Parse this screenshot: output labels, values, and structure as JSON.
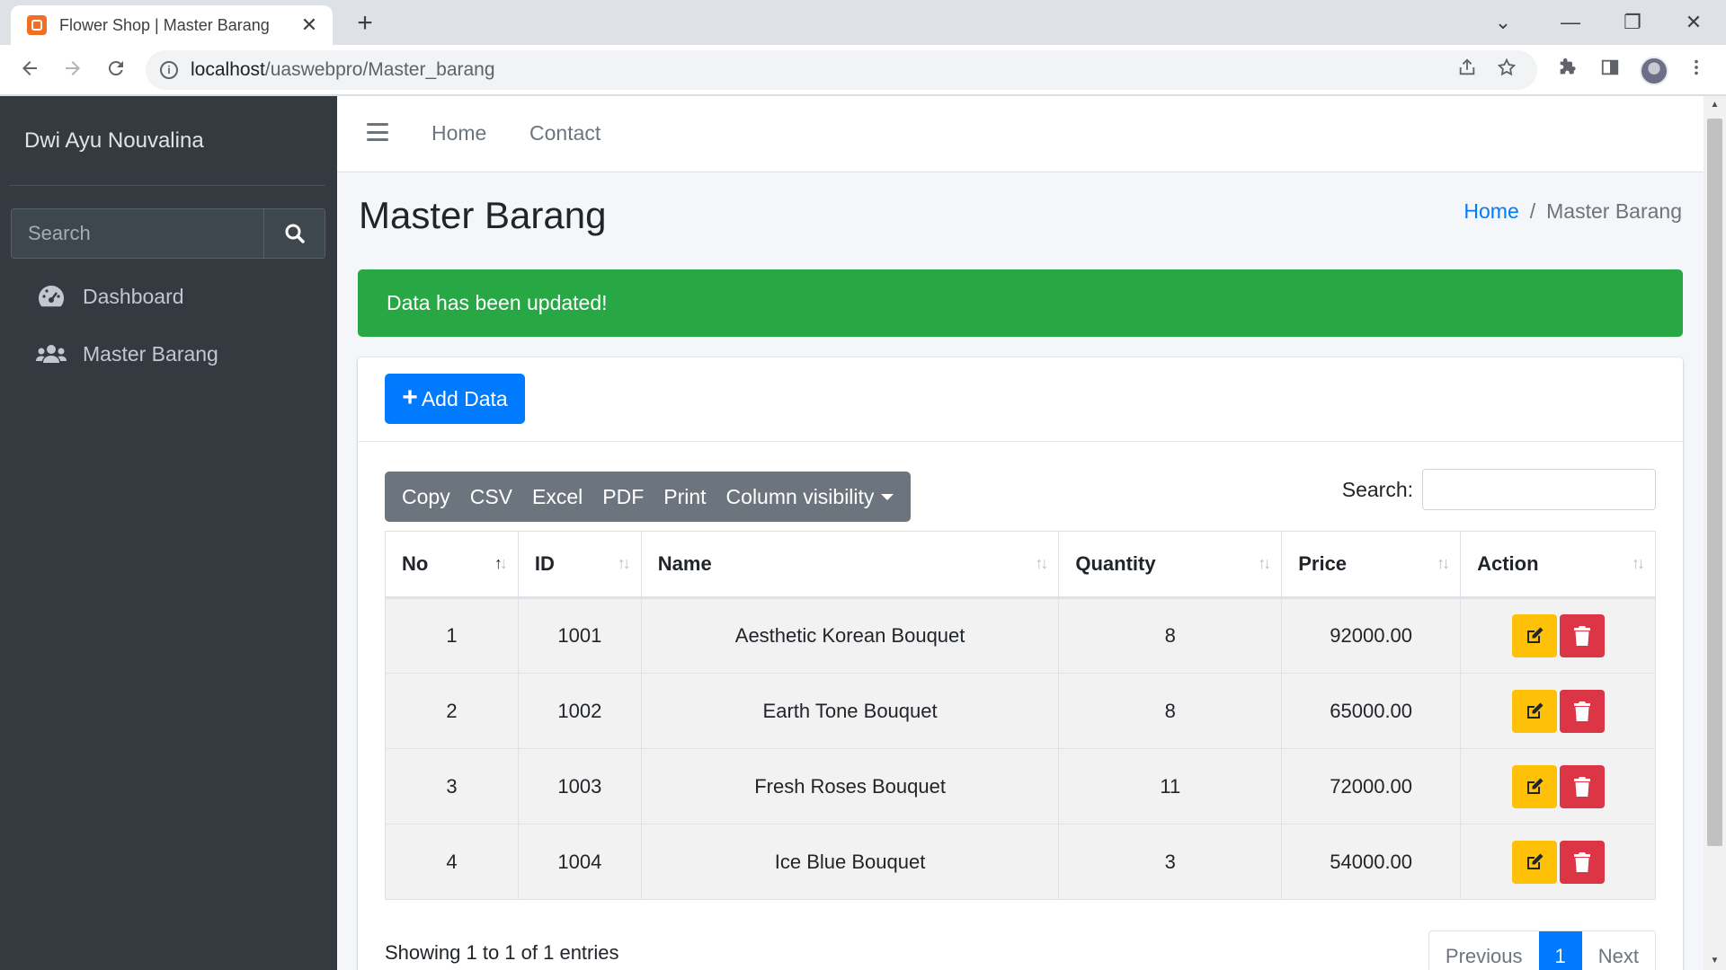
{
  "browser": {
    "tab_title": "Flower Shop | Master Barang",
    "tab_close": "✕",
    "new_tab": "+",
    "url_host": "localhost",
    "url_path": "/uaswebpro/Master_barang",
    "window_controls": [
      "⌄",
      "—",
      "❐",
      "✕"
    ]
  },
  "sidebar": {
    "brand": "Dwi Ayu Nouvalina",
    "search_placeholder": "Search",
    "items": [
      {
        "label": "Dashboard",
        "icon": "tachometer-icon"
      },
      {
        "label": "Master Barang",
        "icon": "users-icon"
      }
    ]
  },
  "topnav": {
    "links": [
      "Home",
      "Contact"
    ]
  },
  "page": {
    "title": "Master Barang",
    "breadcrumb": {
      "home": "Home",
      "sep": "/",
      "current": "Master Barang"
    },
    "alert": "Data has been updated!",
    "add_button": "Add Data",
    "export_buttons": [
      "Copy",
      "CSV",
      "Excel",
      "PDF",
      "Print",
      "Column visibility"
    ],
    "search_label": "Search:",
    "table": {
      "headers": [
        "No",
        "ID",
        "Name",
        "Quantity",
        "Price",
        "Action"
      ],
      "rows": [
        {
          "no": "1",
          "id": "1001",
          "name": "Aesthetic Korean Bouquet",
          "qty": "8",
          "price": "92000.00"
        },
        {
          "no": "2",
          "id": "1002",
          "name": "Earth Tone Bouquet",
          "qty": "8",
          "price": "65000.00"
        },
        {
          "no": "3",
          "id": "1003",
          "name": "Fresh Roses Bouquet",
          "qty": "11",
          "price": "72000.00"
        },
        {
          "no": "4",
          "id": "1004",
          "name": "Ice Blue Bouquet",
          "qty": "3",
          "price": "54000.00"
        }
      ]
    },
    "info": "Showing 1 to 1 of 1 entries",
    "pagination": {
      "previous": "Previous",
      "current": "1",
      "next": "Next"
    }
  },
  "colors": {
    "sidebar_bg": "#343a40",
    "primary": "#007bff",
    "success": "#28a745",
    "warning": "#ffc107",
    "danger": "#dc3545",
    "secondary": "#6c757d"
  }
}
